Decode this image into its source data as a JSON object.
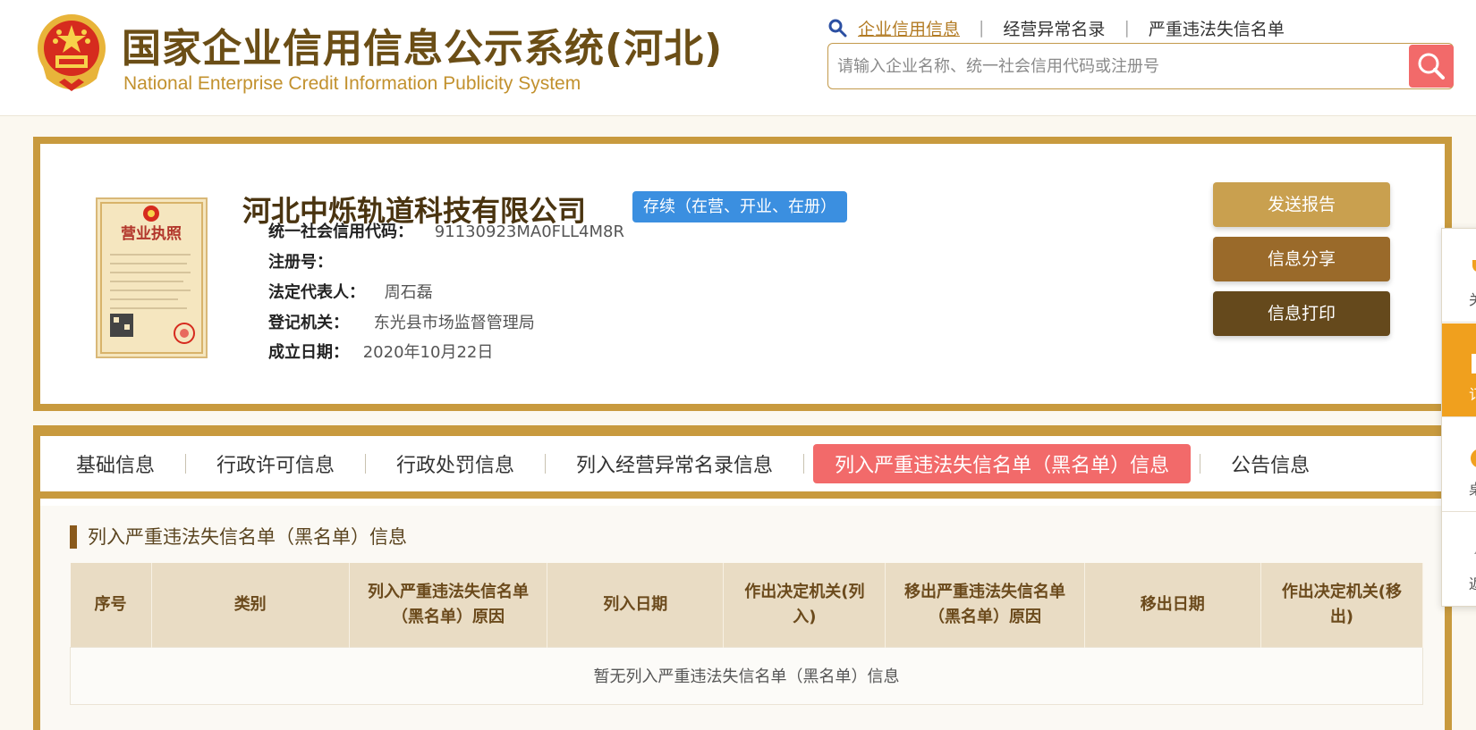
{
  "header": {
    "title": "国家企业信用信息公示系统(河北)",
    "subtitle": "National Enterprise Credit Information Publicity System",
    "nav": [
      {
        "label": "企业信用信息",
        "active": true
      },
      {
        "label": "经营异常名录",
        "active": false
      },
      {
        "label": "严重违法失信名单",
        "active": false
      }
    ],
    "search": {
      "placeholder": "请输入企业名称、统一社会信用代码或注册号",
      "value": ""
    }
  },
  "company": {
    "name": "河北中烁轨道科技有限公司",
    "status": "存续（在营、开业、在册）",
    "license_caption": "营业执照",
    "fields": [
      {
        "label": "统一社会信用代码：",
        "value": "91130923MA0FLL4M8R"
      },
      {
        "label": "注册号：",
        "value": ""
      },
      {
        "label": "法定代表人：",
        "value": "周石磊"
      },
      {
        "label": "登记机关：",
        "value": "东光县市场监督管理局"
      },
      {
        "label": "成立日期：",
        "value": "2020年10月22日"
      }
    ],
    "actions": [
      {
        "label": "发送报告",
        "color": "#c9a04f"
      },
      {
        "label": "信息分享",
        "color": "#9a6a2a"
      },
      {
        "label": "信息打印",
        "color": "#65491c"
      }
    ]
  },
  "tabs": [
    {
      "label": "基础信息",
      "active": false
    },
    {
      "label": "行政许可信息",
      "active": false
    },
    {
      "label": "行政处罚信息",
      "active": false
    },
    {
      "label": "列入经营异常名录信息",
      "active": false
    },
    {
      "label": "列入严重违法失信名单（黑名单）信息",
      "active": true
    },
    {
      "label": "公告信息",
      "active": false
    }
  ],
  "section": {
    "title": "列入严重违法失信名单（黑名单）信息",
    "columns": [
      "序号",
      "类别",
      "列入严重违法失信名单（黑名单）原因",
      "列入日期",
      "作出决定机关(列入)",
      "移出严重违法失信名单（黑名单）原因",
      "移出日期",
      "作出决定机关(移出)"
    ],
    "empty_text": "暂无列入严重违法失信名单（黑名单）信息"
  },
  "float_bar": {
    "items": [
      {
        "text": "关",
        "icon": "trophy-icon",
        "active": false
      },
      {
        "text": "订",
        "icon": "document-icon",
        "active": true
      },
      {
        "text": "桌",
        "icon": "circle-icon",
        "active": false
      },
      {
        "text": "返",
        "icon": "arrow-up-icon",
        "active": false
      }
    ]
  },
  "colors": {
    "brand_brown": "#6b4e16",
    "gold_border": "#c89a3e",
    "active_tab_red": "#f26a6a",
    "status_blue": "#3b8fe0",
    "float_active_orange": "#f0a01e"
  }
}
